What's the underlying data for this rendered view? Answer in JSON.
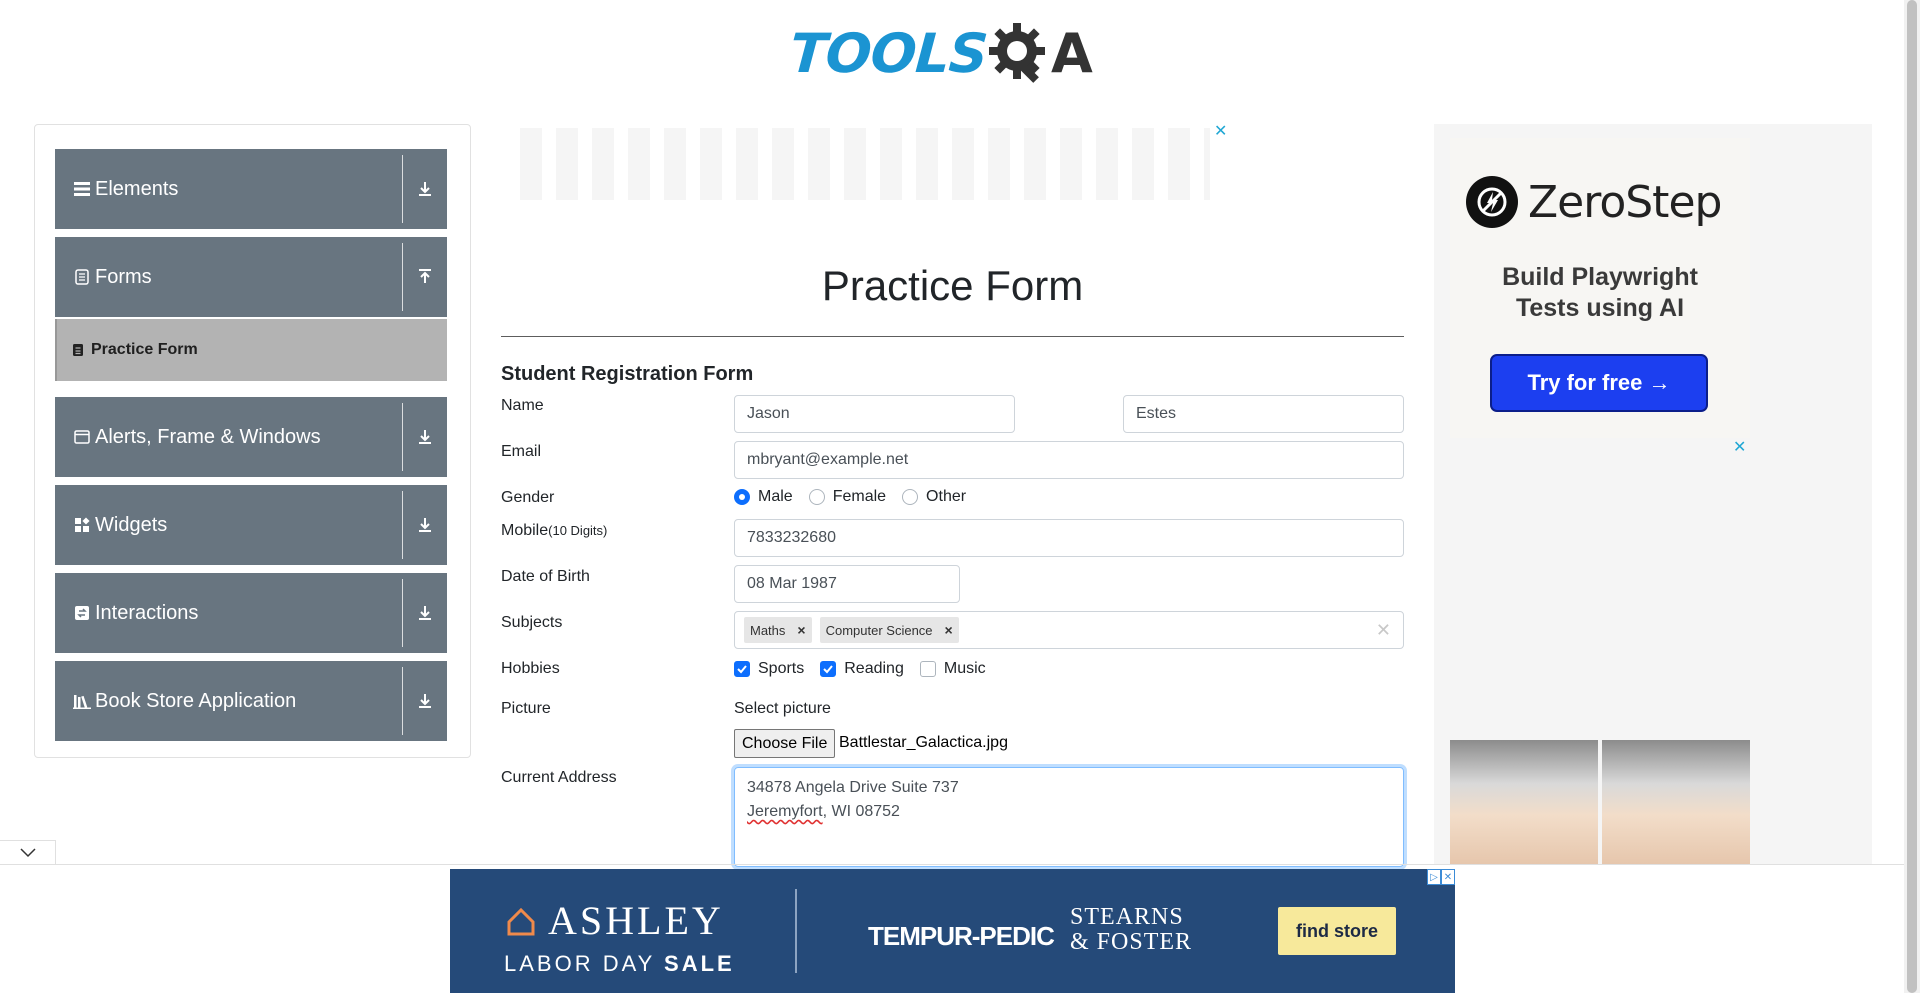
{
  "header": {
    "logo_text_left": "TOOLS",
    "logo_text_right": "A"
  },
  "sidebar": {
    "groups": [
      {
        "label": "Elements",
        "icon": "hamburger-icon",
        "toggle": "expand"
      },
      {
        "label": "Forms",
        "icon": "document-icon",
        "toggle": "collapse"
      },
      {
        "label": "Alerts, Frame & Windows",
        "icon": "window-icon",
        "toggle": "expand"
      },
      {
        "label": "Widgets",
        "icon": "widgets-icon",
        "toggle": "expand"
      },
      {
        "label": "Interactions",
        "icon": "interactions-icon",
        "toggle": "expand"
      },
      {
        "label": "Book Store Application",
        "icon": "books-icon",
        "toggle": "expand"
      }
    ],
    "active_item": "Practice Form"
  },
  "main": {
    "title": "Practice Form",
    "subtitle": "Student Registration Form",
    "labels": {
      "name": "Name",
      "email": "Email",
      "gender": "Gender",
      "mobile": "Mobile",
      "mobile_hint": "(10 Digits)",
      "dob": "Date of Birth",
      "subjects": "Subjects",
      "hobbies": "Hobbies",
      "picture": "Picture",
      "address": "Current Address"
    },
    "first_name": "Jason",
    "last_name": "Estes",
    "email": "mbryant@example.net",
    "gender_options": [
      "Male",
      "Female",
      "Other"
    ],
    "gender_selected": "Male",
    "mobile": "7833232680",
    "dob": "08 Mar 1987",
    "subjects": [
      "Maths",
      "Computer Science"
    ],
    "hobbies": [
      {
        "label": "Sports",
        "checked": true
      },
      {
        "label": "Reading",
        "checked": true
      },
      {
        "label": "Music",
        "checked": false
      }
    ],
    "picture_prompt": "Select picture",
    "file_button": "Choose File",
    "file_name": "Battlestar_Galactica.jpg",
    "address_line1": "34878 Angela Drive Suite 737",
    "address_line2_a": "Jeremyfort",
    "address_line2_b": ", WI 08752"
  },
  "right_ad": {
    "brand": "ZeroStep",
    "tagline_1": "Build Playwright",
    "tagline_2": "Tests using AI",
    "cta": "Try for free →"
  },
  "bottom_ad": {
    "brand": "ASHLEY",
    "sale_a": "LABOR DAY ",
    "sale_b": "SALE",
    "partner1": "TEMPUR-PEDIC",
    "partner2_line1": "STEARNS",
    "partner2_line2": "& FOSTER",
    "cta": "find store"
  },
  "colors": {
    "sidebar_group": "#687580",
    "active_item": "#b3b3b3",
    "primary": "#0d6efd",
    "logo_blue": "#1b94d2"
  }
}
